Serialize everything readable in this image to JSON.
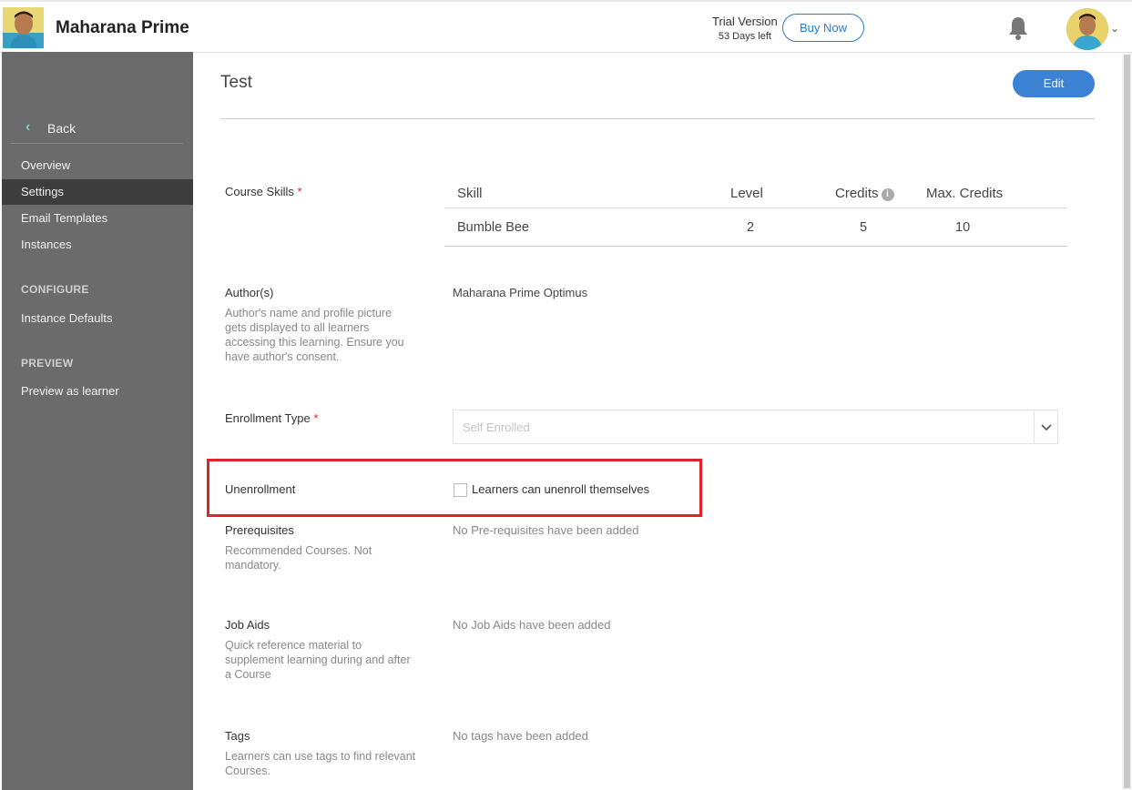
{
  "header": {
    "brand": "Maharana Prime",
    "trial_title": "Trial Version",
    "trial_days": "53 Days left",
    "buy_now": "Buy Now"
  },
  "sidebar": {
    "back": "Back",
    "items": [
      "Overview",
      "Settings",
      "Email Templates",
      "Instances"
    ],
    "active": "Settings",
    "configure_title": "CONFIGURE",
    "configure_items": [
      "Instance Defaults"
    ],
    "preview_title": "PREVIEW",
    "preview_items": [
      "Preview as learner"
    ]
  },
  "main": {
    "title": "Test",
    "edit": "Edit",
    "course_skills": {
      "label": "Course Skills",
      "required": "*",
      "headers": [
        "Skill",
        "Level",
        "Credits",
        "Max. Credits"
      ],
      "rows": [
        {
          "skill": "Bumble Bee",
          "level": "2",
          "credits": "5",
          "max_credits": "10"
        }
      ]
    },
    "authors": {
      "label": "Author(s)",
      "help": "Author's name and profile picture gets displayed to all learners accessing this learning. Ensure you have author's consent.",
      "value": "Maharana Prime Optimus"
    },
    "enrollment": {
      "label": "Enrollment Type",
      "required": "*",
      "value": "Self Enrolled"
    },
    "unenrollment": {
      "label": "Unenrollment",
      "checkbox_label": "Learners can unenroll themselves",
      "checked": false
    },
    "prerequisites": {
      "label": "Prerequisites",
      "help": "Recommended Courses. Not mandatory.",
      "value": "No Pre-requisites have been added"
    },
    "job_aids": {
      "label": "Job Aids",
      "help": "Quick reference material to supplement learning during and after a Course",
      "value": "No Job Aids have been added"
    },
    "tags": {
      "label": "Tags",
      "help": "Learners can use tags to find relevant Courses.",
      "value": "No tags have been added"
    }
  },
  "colors": {
    "accent": "#3b82d4",
    "sidebar": "#6b6b6b",
    "highlight": "#e0222c"
  }
}
